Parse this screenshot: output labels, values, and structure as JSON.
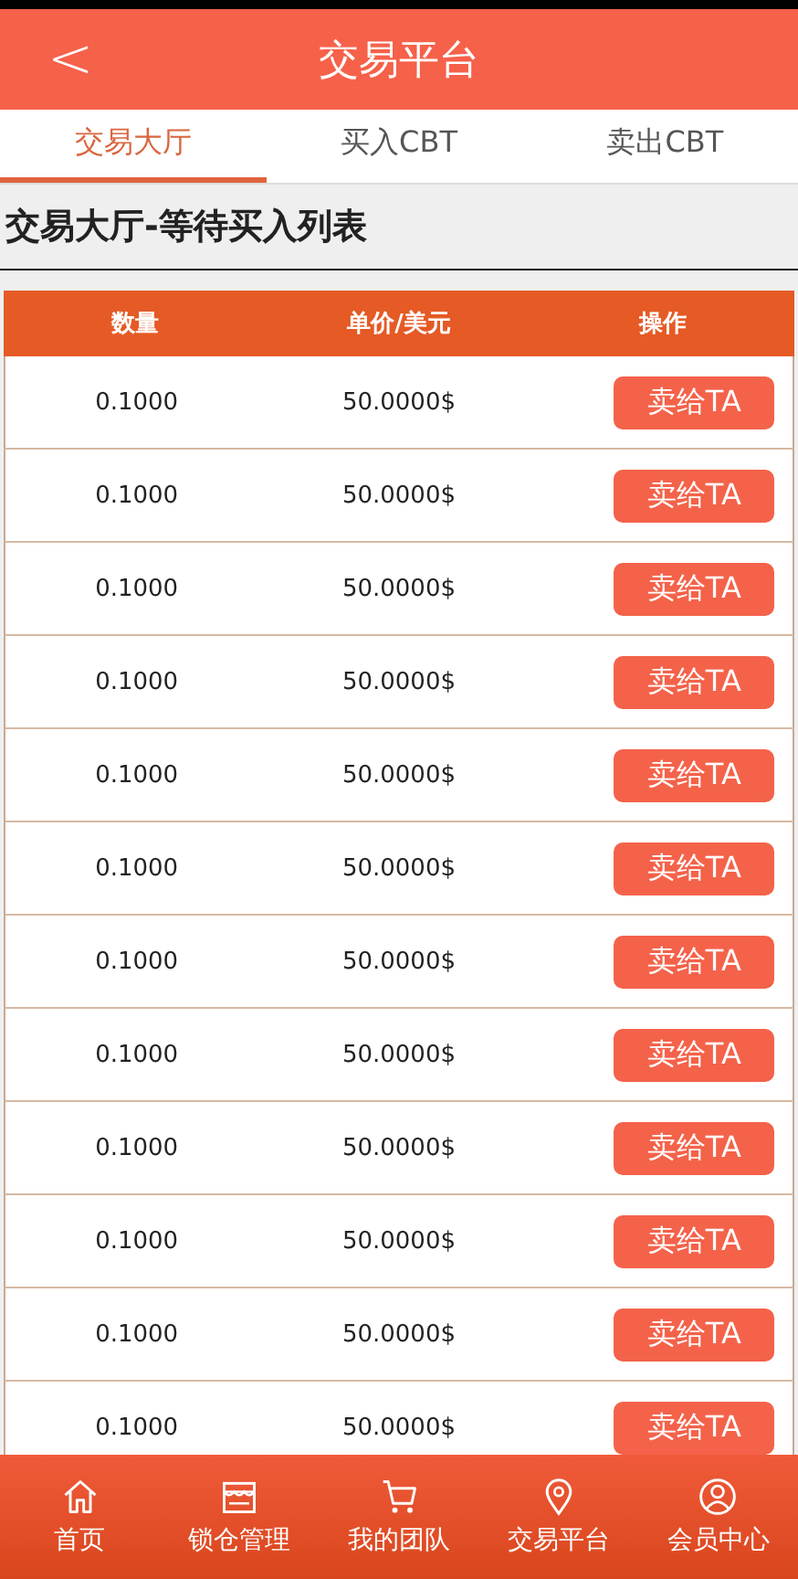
{
  "header": {
    "back": "<",
    "title": "交易平台"
  },
  "tabs": [
    {
      "label": "交易大厅",
      "selected": true
    },
    {
      "label": "买入CBT",
      "selected": false
    },
    {
      "label": "卖出CBT",
      "selected": false
    }
  ],
  "section_title": "交易大厅-等待买入列表",
  "table": {
    "columns": [
      "数量",
      "单价/美元",
      "操作"
    ],
    "rows": [
      {
        "quantity": "0.1000",
        "price": "50.0000$",
        "action": "卖给TA"
      },
      {
        "quantity": "0.1000",
        "price": "50.0000$",
        "action": "卖给TA"
      },
      {
        "quantity": "0.1000",
        "price": "50.0000$",
        "action": "卖给TA"
      },
      {
        "quantity": "0.1000",
        "price": "50.0000$",
        "action": "卖给TA"
      },
      {
        "quantity": "0.1000",
        "price": "50.0000$",
        "action": "卖给TA"
      },
      {
        "quantity": "0.1000",
        "price": "50.0000$",
        "action": "卖给TA"
      },
      {
        "quantity": "0.1000",
        "price": "50.0000$",
        "action": "卖给TA"
      },
      {
        "quantity": "0.1000",
        "price": "50.0000$",
        "action": "卖给TA"
      },
      {
        "quantity": "0.1000",
        "price": "50.0000$",
        "action": "卖给TA"
      },
      {
        "quantity": "0.1000",
        "price": "50.0000$",
        "action": "卖给TA"
      },
      {
        "quantity": "0.1000",
        "price": "50.0000$",
        "action": "卖给TA"
      },
      {
        "quantity": "0.1000",
        "price": "50.0000$",
        "action": "卖给TA"
      }
    ]
  },
  "bottom_nav": [
    {
      "kind": "home",
      "label": "首页"
    },
    {
      "kind": "store",
      "label": "锁仓管理"
    },
    {
      "kind": "cart",
      "label": "我的团队"
    },
    {
      "kind": "pin",
      "label": "交易平台"
    },
    {
      "kind": "user",
      "label": "会员中心"
    }
  ]
}
